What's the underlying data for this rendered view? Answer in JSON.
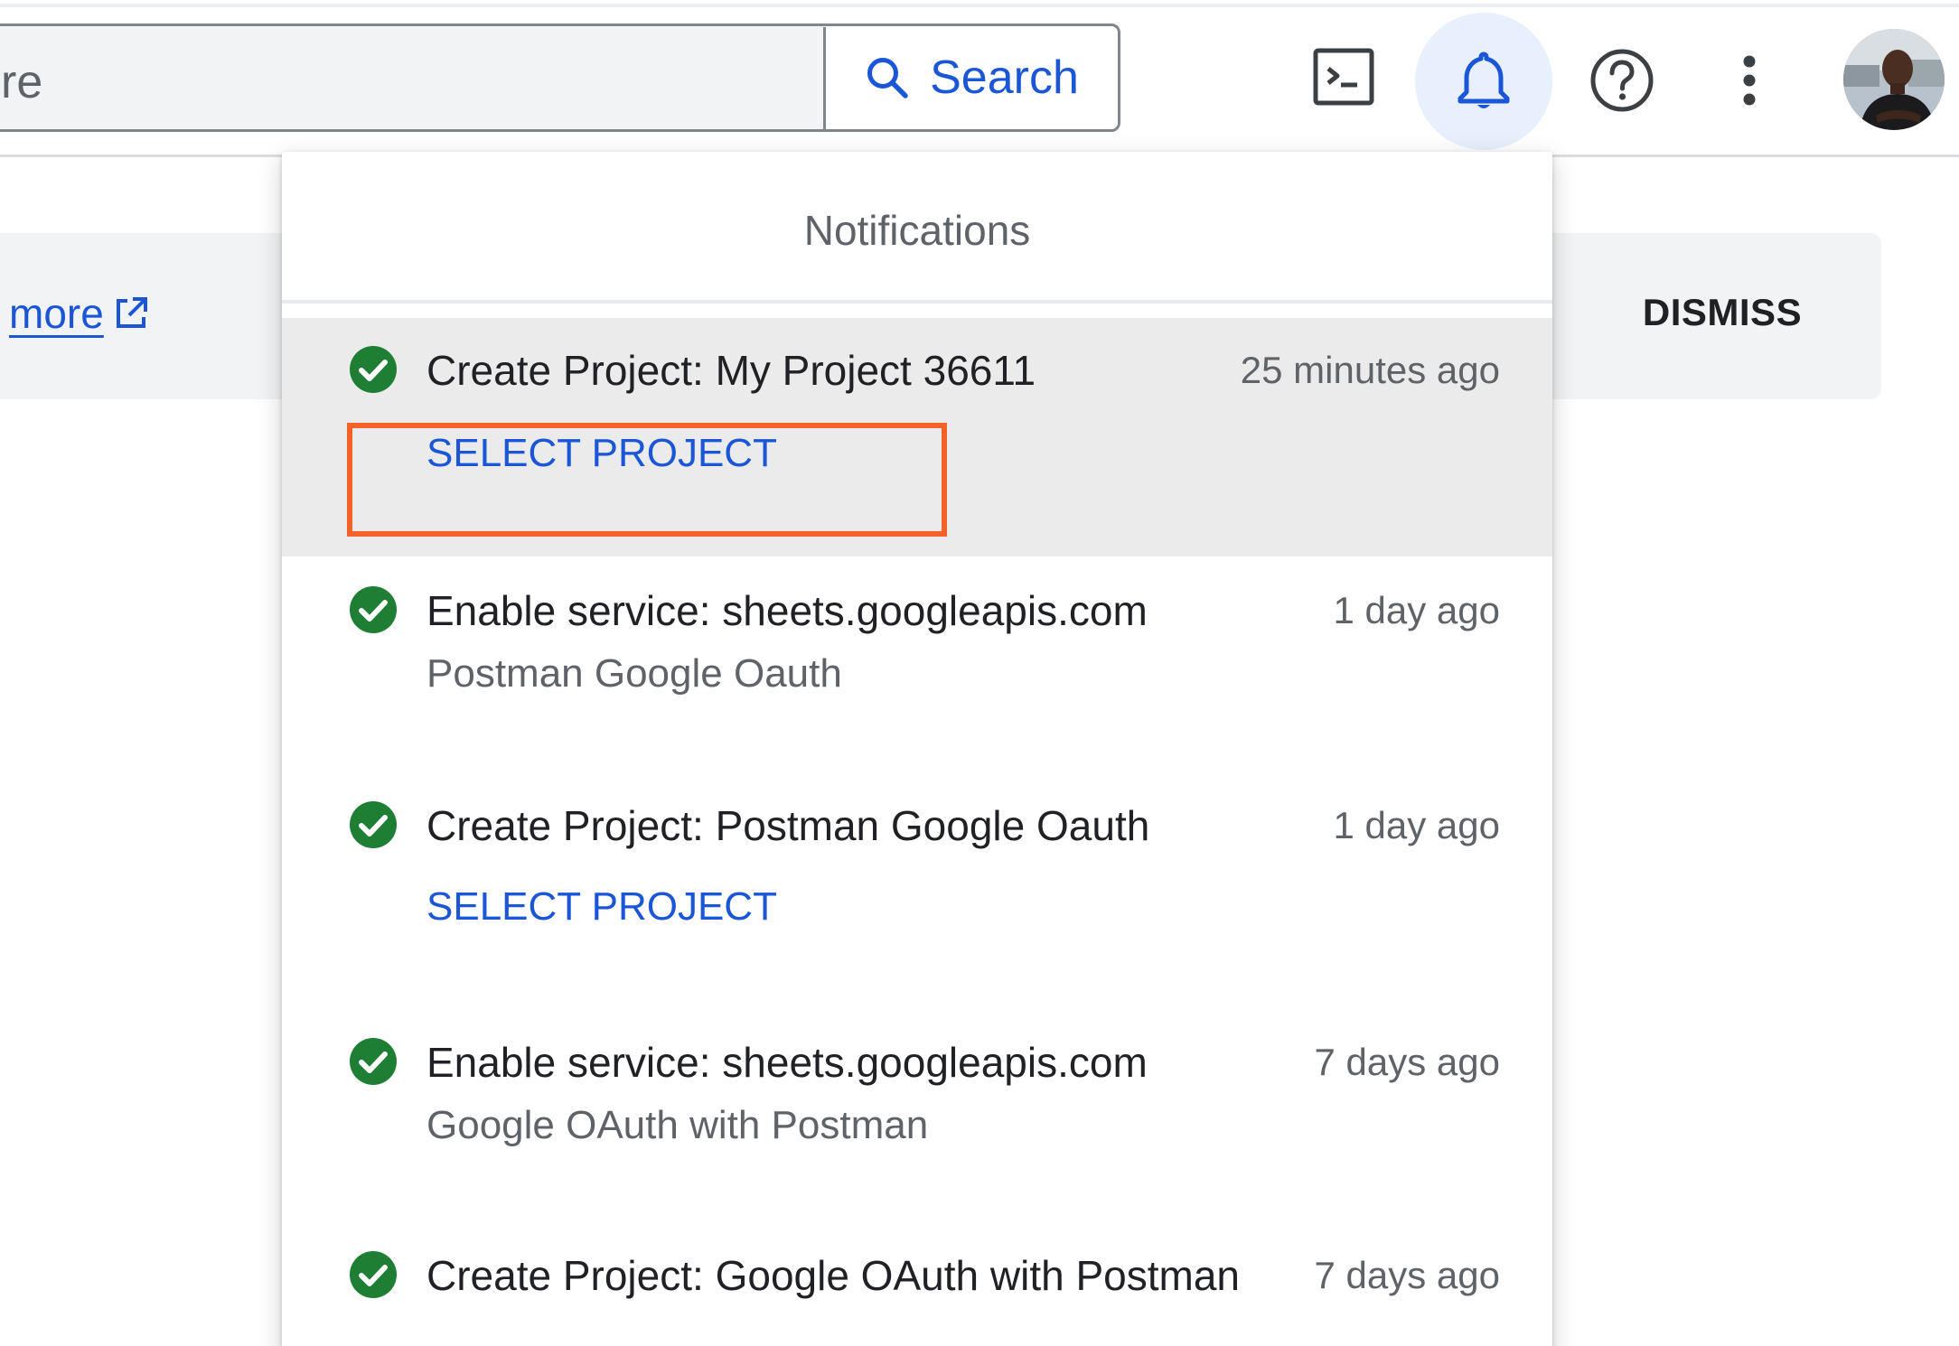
{
  "topbar": {
    "search_value": "re",
    "search_button_label": "Search",
    "icons": {
      "terminal": "cloud-shell-icon",
      "notifications": "bell-icon",
      "help": "help-icon",
      "more": "more-vert-icon"
    }
  },
  "banner": {
    "learn_more_label": "more",
    "dismiss_label": "DISMISS"
  },
  "notifications": {
    "title": "Notifications",
    "items": [
      {
        "title": "Create Project: My Project 36611",
        "time": "25 minutes ago",
        "action": "SELECT PROJECT"
      },
      {
        "title": "Enable service: sheets.googleapis.com",
        "time": "1 day ago",
        "subtitle": "Postman Google Oauth"
      },
      {
        "title": "Create Project: Postman Google Oauth",
        "time": "1 day ago",
        "action": "SELECT PROJECT"
      },
      {
        "title": "Enable service: sheets.googleapis.com",
        "time": "7 days ago",
        "subtitle": "Google OAuth with Postman"
      },
      {
        "title": "Create Project: Google OAuth with Postman",
        "time": "7 days ago"
      }
    ]
  },
  "colors": {
    "accent_blue": "#1a56d6",
    "success_green": "#1e7e34",
    "highlight_orange": "#f4622a"
  }
}
